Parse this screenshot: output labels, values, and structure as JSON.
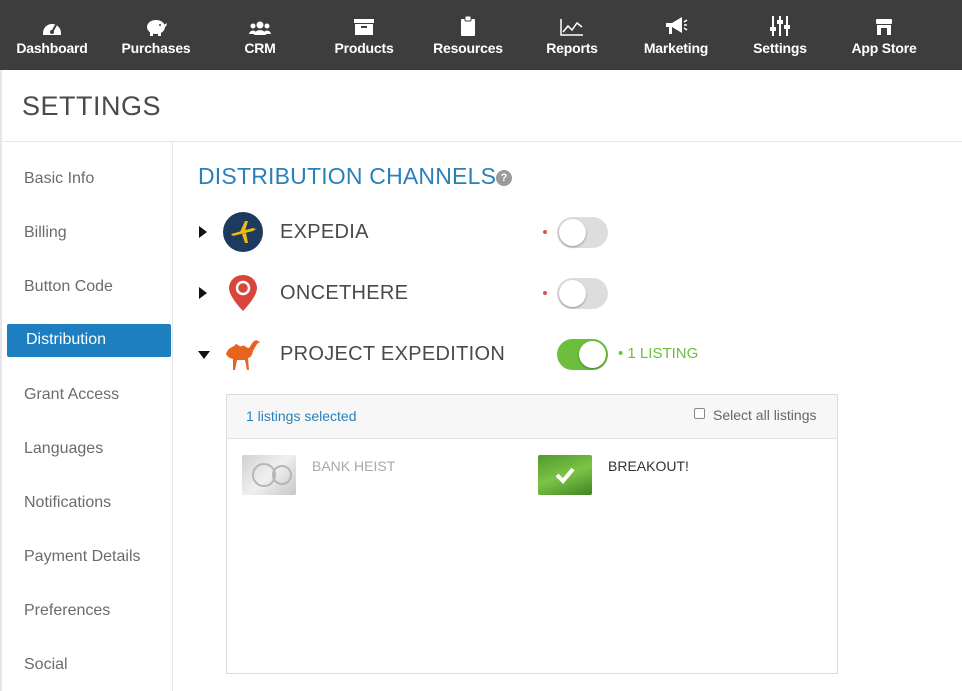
{
  "nav": {
    "items": [
      {
        "label": "Dashboard",
        "icon": "dashboard-icon"
      },
      {
        "label": "Purchases",
        "icon": "piggy-bank-icon"
      },
      {
        "label": "CRM",
        "icon": "users-icon"
      },
      {
        "label": "Products",
        "icon": "archive-box-icon"
      },
      {
        "label": "Resources",
        "icon": "clipboard-icon"
      },
      {
        "label": "Reports",
        "icon": "line-chart-icon"
      },
      {
        "label": "Marketing",
        "icon": "megaphone-icon"
      },
      {
        "label": "Settings",
        "icon": "sliders-icon"
      },
      {
        "label": "App Store",
        "icon": "store-icon"
      }
    ]
  },
  "header": {
    "title": "SETTINGS"
  },
  "sidebar": {
    "items": [
      {
        "label": "Basic Info"
      },
      {
        "label": "Billing"
      },
      {
        "label": "Button Code"
      },
      {
        "label": "Distribution",
        "active": true
      },
      {
        "label": "Grant Access"
      },
      {
        "label": "Languages"
      },
      {
        "label": "Notifications"
      },
      {
        "label": "Payment Details"
      },
      {
        "label": "Preferences"
      },
      {
        "label": "Social"
      }
    ]
  },
  "main": {
    "title": "DISTRIBUTION CHANNELS",
    "help_icon": "?",
    "channels": [
      {
        "name": "EXPEDIA",
        "icon": "airplane-icon",
        "enabled": false,
        "expanded": false
      },
      {
        "name": "ONCETHERE",
        "icon": "map-pin-icon",
        "enabled": false,
        "expanded": false
      },
      {
        "name": "PROJECT EXPEDITION",
        "icon": "camel-icon",
        "enabled": true,
        "expanded": true,
        "listing_count": "1 LISTING"
      }
    ],
    "listings_panel": {
      "selected_text": "1 listings selected",
      "select_all_label": "Select all listings",
      "select_all_checked": false,
      "listings": [
        {
          "name": "BANK HEIST",
          "selected": false
        },
        {
          "name": "BREAKOUT!",
          "selected": true
        }
      ]
    }
  },
  "colors": {
    "accent": "#2a80b9",
    "active_sidebar": "#1d7fbf",
    "toggle_on": "#6cbe3c",
    "nav_bg": "#3d3d3d",
    "required_dot": "#d9534f"
  }
}
